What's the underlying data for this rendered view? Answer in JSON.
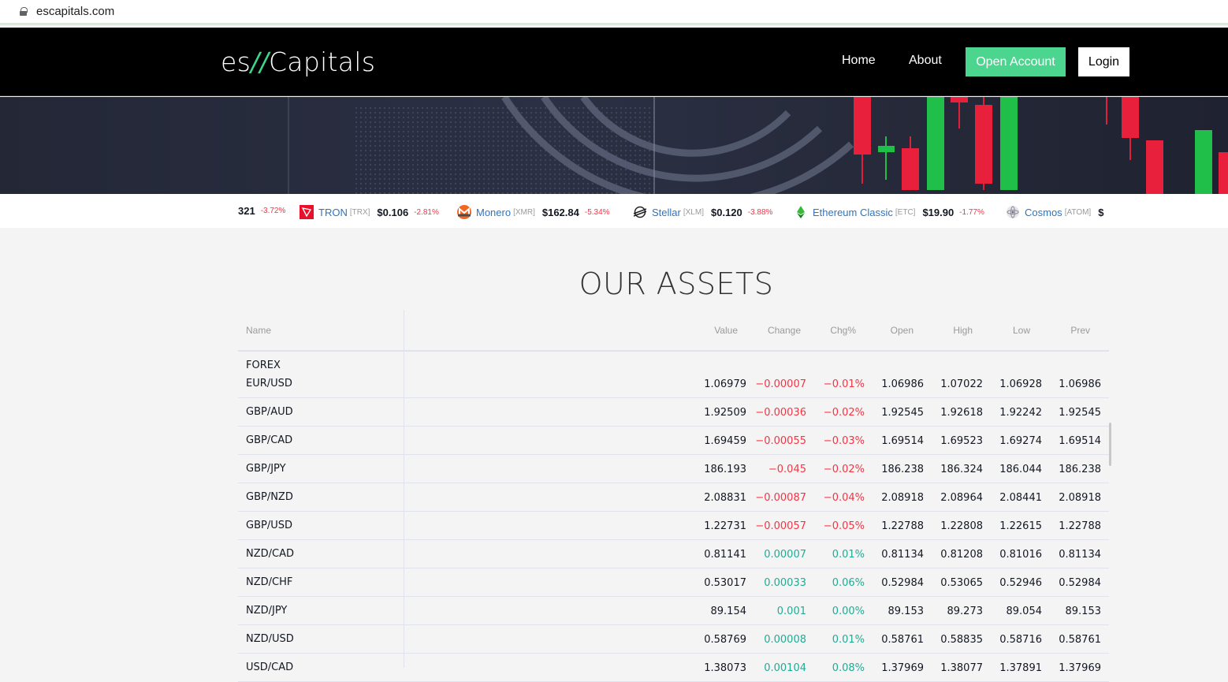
{
  "browser": {
    "url": "escapitals.com"
  },
  "nav": {
    "logo_left": "es",
    "logo_slash": "//",
    "logo_right": "Capitals",
    "home": "Home",
    "about": "About",
    "open_account": "Open Account",
    "login": "Login"
  },
  "ticker": {
    "partial_price": "321",
    "partial_change": "-3.72%",
    "items": [
      {
        "name": "TRON",
        "symbol": "[TRX]",
        "price": "$0.106",
        "change": "-2.81%",
        "icon": "tron-icon"
      },
      {
        "name": "Monero",
        "symbol": "[XMR]",
        "price": "$162.84",
        "change": "-5.34%",
        "icon": "monero-icon"
      },
      {
        "name": "Stellar",
        "symbol": "[XLM]",
        "price": "$0.120",
        "change": "-3.88%",
        "icon": "stellar-icon"
      },
      {
        "name": "Ethereum Classic",
        "symbol": "[ETC]",
        "price": "$19.90",
        "change": "-1.77%",
        "icon": "ethereum-classic-icon"
      },
      {
        "name": "Cosmos",
        "symbol": "[ATOM]",
        "price": "$",
        "change": "",
        "icon": "cosmos-icon"
      }
    ]
  },
  "assets": {
    "title": "OUR ASSETS",
    "columns": {
      "name": "Name",
      "value": "Value",
      "change": "Change",
      "chgp": "Chg%",
      "open": "Open",
      "high": "High",
      "low": "Low",
      "prev": "Prev"
    },
    "category": "FOREX",
    "rows": [
      {
        "name": "EUR/USD",
        "value": "1.06979",
        "change": "−0.00007",
        "chgp": "−0.01%",
        "open": "1.06986",
        "high": "1.07022",
        "low": "1.06928",
        "prev": "1.06986",
        "dir": "neg"
      },
      {
        "name": "GBP/AUD",
        "value": "1.92509",
        "change": "−0.00036",
        "chgp": "−0.02%",
        "open": "1.92545",
        "high": "1.92618",
        "low": "1.92242",
        "prev": "1.92545",
        "dir": "neg"
      },
      {
        "name": "GBP/CAD",
        "value": "1.69459",
        "change": "−0.00055",
        "chgp": "−0.03%",
        "open": "1.69514",
        "high": "1.69523",
        "low": "1.69274",
        "prev": "1.69514",
        "dir": "neg"
      },
      {
        "name": "GBP/JPY",
        "value": "186.193",
        "change": "−0.045",
        "chgp": "−0.02%",
        "open": "186.238",
        "high": "186.324",
        "low": "186.044",
        "prev": "186.238",
        "dir": "neg"
      },
      {
        "name": "GBP/NZD",
        "value": "2.08831",
        "change": "−0.00087",
        "chgp": "−0.04%",
        "open": "2.08918",
        "high": "2.08964",
        "low": "2.08441",
        "prev": "2.08918",
        "dir": "neg"
      },
      {
        "name": "GBP/USD",
        "value": "1.22731",
        "change": "−0.00057",
        "chgp": "−0.05%",
        "open": "1.22788",
        "high": "1.22808",
        "low": "1.22615",
        "prev": "1.22788",
        "dir": "neg"
      },
      {
        "name": "NZD/CAD",
        "value": "0.81141",
        "change": "0.00007",
        "chgp": "0.01%",
        "open": "0.81134",
        "high": "0.81208",
        "low": "0.81016",
        "prev": "0.81134",
        "dir": "pos"
      },
      {
        "name": "NZD/CHF",
        "value": "0.53017",
        "change": "0.00033",
        "chgp": "0.06%",
        "open": "0.52984",
        "high": "0.53065",
        "low": "0.52946",
        "prev": "0.52984",
        "dir": "pos"
      },
      {
        "name": "NZD/JPY",
        "value": "89.154",
        "change": "0.001",
        "chgp": "0.00%",
        "open": "89.153",
        "high": "89.273",
        "low": "89.054",
        "prev": "89.153",
        "dir": "pos"
      },
      {
        "name": "NZD/USD",
        "value": "0.58769",
        "change": "0.00008",
        "chgp": "0.01%",
        "open": "0.58761",
        "high": "0.58835",
        "low": "0.58716",
        "prev": "0.58761",
        "dir": "pos"
      },
      {
        "name": "USD/CAD",
        "value": "1.38073",
        "change": "0.00104",
        "chgp": "0.08%",
        "open": "1.37969",
        "high": "1.38077",
        "low": "1.37891",
        "prev": "1.37969",
        "dir": "pos"
      }
    ]
  },
  "colors": {
    "accent": "#4cd58f",
    "negative": "#f23645",
    "positive": "#22ab94",
    "link": "#2f74c0"
  }
}
